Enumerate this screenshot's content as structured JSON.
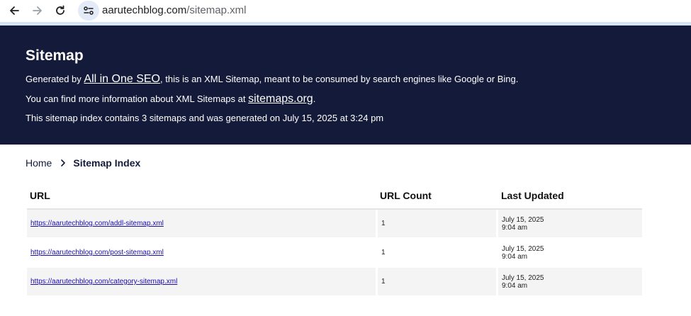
{
  "browser": {
    "address_host": "aarutechblog.com",
    "address_path": "/sitemap.xml"
  },
  "header": {
    "title": "Sitemap",
    "line1_prefix": "Generated by ",
    "line1_link": "All in One SEO",
    "line1_suffix": ", this is an XML Sitemap, meant to be consumed by search engines like Google or Bing.",
    "line2_prefix": "You can find more information about XML Sitemaps at ",
    "line2_link": "sitemaps.org",
    "line2_suffix": ".",
    "line3": "This sitemap index contains 3 sitemaps and was generated on July 15, 2025 at 3:24 pm"
  },
  "breadcrumb": {
    "home": "Home",
    "current": "Sitemap Index"
  },
  "table": {
    "columns": [
      "URL",
      "URL Count",
      "Last Updated"
    ],
    "rows": [
      {
        "url": "https://aarutechblog.com/addl-sitemap.xml",
        "count": "1",
        "date": "July 15, 2025",
        "time": "9:04 am"
      },
      {
        "url": "https://aarutechblog.com/post-sitemap.xml",
        "count": "1",
        "date": "July 15, 2025",
        "time": "9:04 am"
      },
      {
        "url": "https://aarutechblog.com/category-sitemap.xml",
        "count": "1",
        "date": "July 15, 2025",
        "time": "9:04 am"
      }
    ]
  },
  "colors": {
    "header_bg": "#141a3a",
    "link": "#1a0dab",
    "row_alt": "#f4f4f4"
  }
}
